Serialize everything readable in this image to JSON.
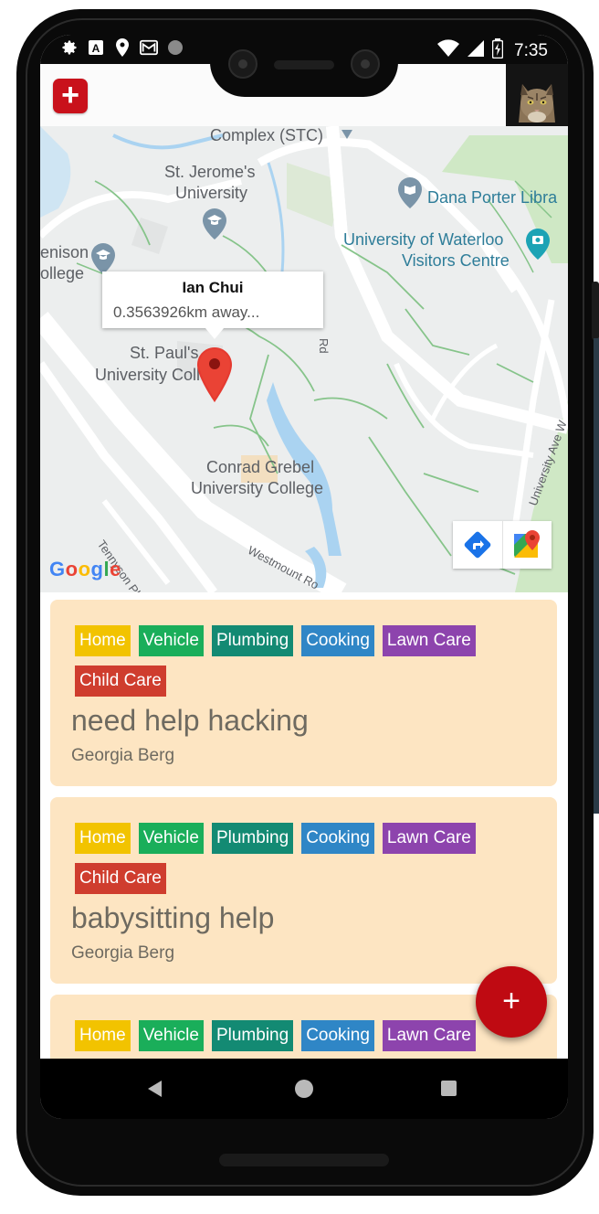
{
  "status_bar": {
    "time": "7:35",
    "left_icons": [
      "gear-icon",
      "a-icon",
      "location-icon",
      "mail-icon",
      "circle-icon"
    ],
    "right_icons": [
      "wifi-icon",
      "signal-icon",
      "battery-icon"
    ]
  },
  "app_bar": {
    "add_label": "+",
    "avatar": "cat-avatar"
  },
  "map": {
    "labels": {
      "complex": "Complex (STC)",
      "st_jerome_1": "St. Jerome's",
      "st_jerome_2": "University",
      "dana": "Dana Porter Libra",
      "uw_1": "University of Waterloo",
      "uw_2": "Visitors Centre",
      "renison_1": "enison",
      "renison_2": "ollege",
      "st_paul_1": "St. Paul's",
      "st_paul_2": "University College",
      "conrad_1": "Conrad Grebel",
      "conrad_2": "University College",
      "tennyson": "Tennyson Pl",
      "westmount": "Westmount Ro",
      "university_ave": "University Ave W",
      "rd": "Rd"
    },
    "info_window": {
      "title": "Ian Chui",
      "subtitle": "0.3563926km away..."
    },
    "google_logo": "Google",
    "logo_letters": [
      "G",
      "o",
      "o",
      "g",
      "l",
      "e"
    ],
    "logo_colors": [
      "#4285F4",
      "#EA4335",
      "#FBBC05",
      "#4285F4",
      "#34A853",
      "#EA4335"
    ]
  },
  "posts": [
    {
      "tags": [
        "Home",
        "Vehicle",
        "Plumbing",
        "Cooking",
        "Lawn Care",
        "Child Care"
      ],
      "title": "need help hacking",
      "author": "Georgia Berg"
    },
    {
      "tags": [
        "Home",
        "Vehicle",
        "Plumbing",
        "Cooking",
        "Lawn Care",
        "Child Care"
      ],
      "title": "babysitting help",
      "author": "Georgia Berg"
    },
    {
      "tags": [
        "Home",
        "Vehicle",
        "Plumbing",
        "Cooking",
        "Lawn Care"
      ],
      "title": "",
      "author": ""
    }
  ],
  "fab": {
    "label": "+"
  },
  "colors": {
    "home": "#f2c300",
    "vehicle": "#1aae5a",
    "plumbing": "#138a73",
    "cooking": "#2f86c6",
    "lawn_care": "#8d44ad",
    "child_care": "#cf3d2e",
    "card_bg": "#fde5c2",
    "accent": "#c9111b"
  }
}
